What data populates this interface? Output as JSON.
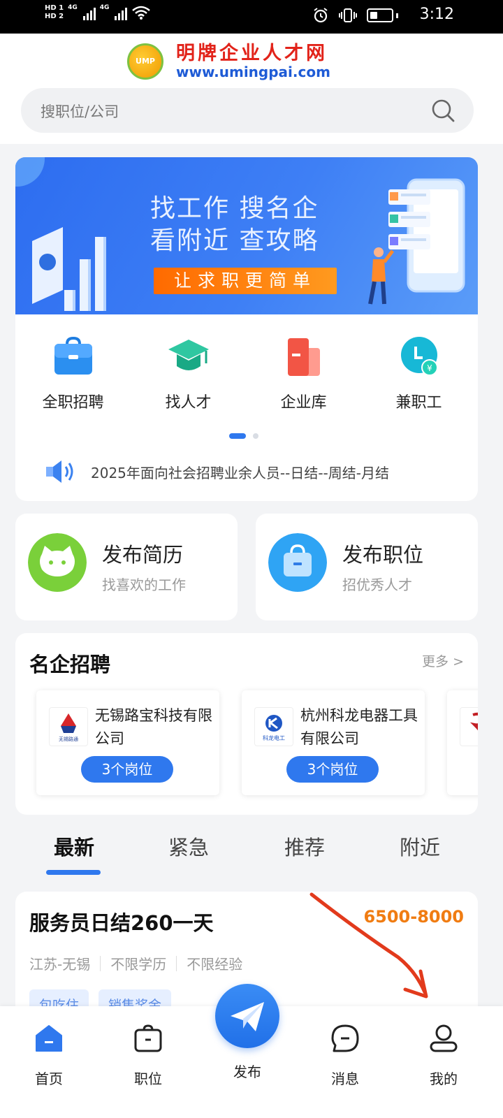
{
  "status_bar": {
    "time": "3:12",
    "network1": "4G",
    "network2": "4G",
    "hd1": "HD 1",
    "hd2": "HD 2",
    "icons": [
      "alarm-icon",
      "vibrate-icon",
      "battery-icon",
      "wifi-icon",
      "signal-icon"
    ]
  },
  "header": {
    "logo_badge": "UMP",
    "logo_name": "明牌企业人才网",
    "logo_url": "www.umingpai.com",
    "search_placeholder": "搜职位/公司"
  },
  "banner": {
    "line1": "找工作    搜名企",
    "line2": "看附近    查攻略",
    "cta": "让求职更简单"
  },
  "categories": [
    {
      "label": "全职招聘",
      "icon": "briefcase-icon"
    },
    {
      "label": "找人才",
      "icon": "graduation-cap-icon"
    },
    {
      "label": "企业库",
      "icon": "building-icon"
    },
    {
      "label": "兼职工",
      "icon": "clock-yuan-icon"
    }
  ],
  "carousel": {
    "pages": 2,
    "current": 1
  },
  "notice": {
    "text": "2025年面向社会招聘业余人员--日结--周结-月结"
  },
  "publish": {
    "resume": {
      "title": "发布简历",
      "subtitle": "找喜欢的工作"
    },
    "job": {
      "title": "发布职位",
      "subtitle": "招优秀人才"
    }
  },
  "famous": {
    "title": "名企招聘",
    "more": "更多 >",
    "companies": [
      {
        "name": "无锡路宝科技有限公司",
        "positions": "3个岗位",
        "logo_text": "无锡路通"
      },
      {
        "name": "杭州科龙电器工具有限公司",
        "positions": "3个岗位",
        "logo_text": "科龙电工"
      }
    ]
  },
  "tabs": [
    "最新",
    "紧急",
    "推荐",
    "附近"
  ],
  "active_tab": "最新",
  "job": {
    "title": "服务员日结260一天",
    "salary": "6500-8000",
    "location": "江苏-无锡",
    "education": "不限学历",
    "experience": "不限经验",
    "tags": [
      "包吃住",
      "销售奖金"
    ]
  },
  "bottom_nav": [
    {
      "label": "首页",
      "icon": "home-icon",
      "active": true
    },
    {
      "label": "职位",
      "icon": "briefcase-icon"
    },
    {
      "label": "发布",
      "icon": "paper-plane-icon"
    },
    {
      "label": "消息",
      "icon": "chat-icon"
    },
    {
      "label": "我的",
      "icon": "user-icon"
    }
  ],
  "colors": {
    "primary": "#2f78ee",
    "salary": "#f07c12",
    "cta": "#ff7a0a",
    "annotation": "#e23a1c"
  }
}
